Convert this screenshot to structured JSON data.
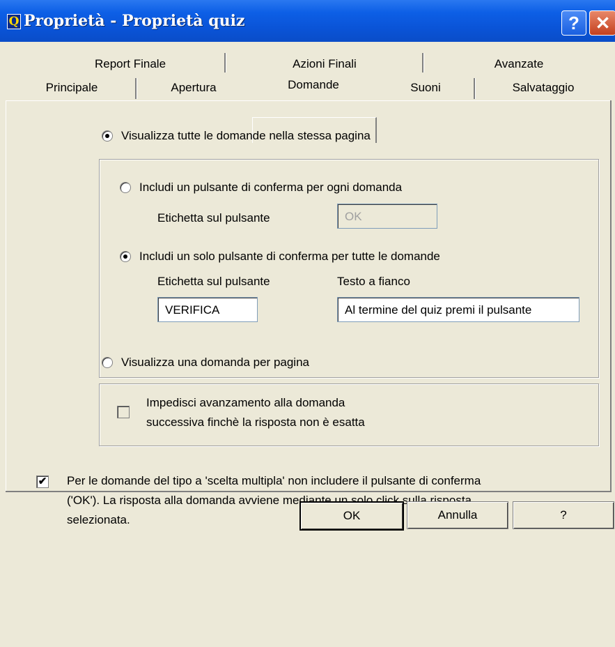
{
  "window": {
    "title": "Proprietà - Proprietà quiz",
    "app_icon_glyph": "Q",
    "help_button": "?",
    "close_button": "✕"
  },
  "tabs": {
    "row1": [
      "Report Finale",
      "Azioni Finali",
      "Avanzate"
    ],
    "row2": [
      "Principale",
      "Apertura",
      "Domande",
      "Suoni",
      "Salvataggio"
    ],
    "selected": "Domande"
  },
  "domande": {
    "all_on_page_label": "Visualizza tutte le domande nella stessa pagina",
    "all_on_page_selected": true,
    "per_question_button_label": "Includi un pulsante di conferma per ogni domanda",
    "per_question_selected": false,
    "per_question_button_text_label": "Etichetta sul pulsante",
    "per_question_button_text_value": "OK",
    "single_button_label": "Includi un solo pulsante di conferma per tutte le domande",
    "single_button_selected": true,
    "single_button_text_label": "Etichetta sul pulsante",
    "single_button_text_value": "VERIFICA",
    "side_text_label": "Testo a fianco",
    "side_text_value": "Al termine del quiz premi il pulsante",
    "one_per_page_label": "Visualizza una domanda per pagina",
    "one_per_page_selected": false,
    "prevent_advance_line1": "Impedisci avanzamento alla domanda",
    "prevent_advance_line2": "successiva finchè la risposta non è esatta",
    "prevent_advance_checked": false,
    "multiple_choice_line1": "Per le domande del tipo a 'scelta multipla' non includere il pulsante di conferma",
    "multiple_choice_line2": "('OK'). La risposta alla domanda avviene mediante un solo click sulla risposta",
    "multiple_choice_line3": "selezionata.",
    "multiple_choice_checked": true
  },
  "buttons": {
    "ok": "OK",
    "cancel": "Annulla",
    "help": "?"
  },
  "check_mark": "✔"
}
